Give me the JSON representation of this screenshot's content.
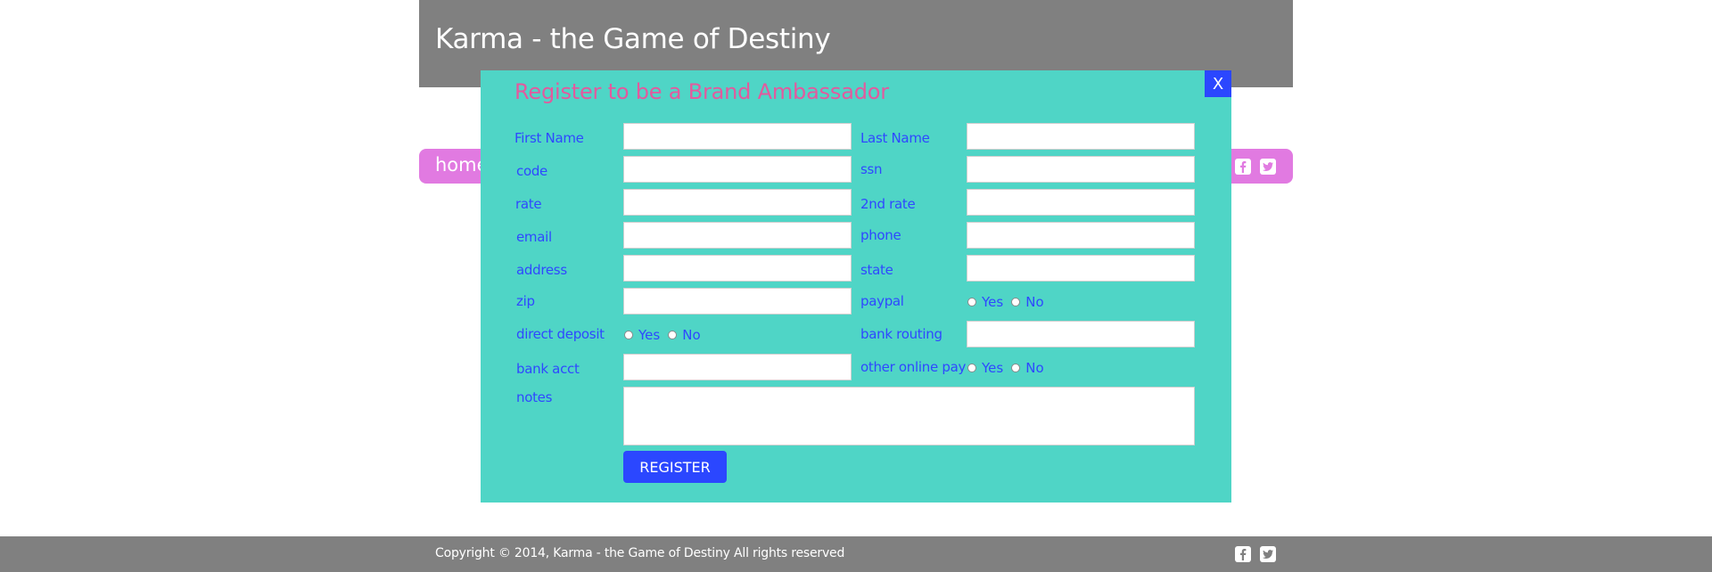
{
  "site": {
    "title": "Karma - the Game of Destiny"
  },
  "nav": {
    "home": "home"
  },
  "social": {
    "facebook_icon": "facebook-icon",
    "twitter_icon": "twitter-icon"
  },
  "modal": {
    "close_label": "X",
    "title": "Register to be a Brand Ambassador",
    "fields": {
      "first_name": {
        "label": "First Name",
        "value": ""
      },
      "last_name": {
        "label": "Last Name",
        "value": ""
      },
      "code": {
        "label": "code",
        "value": ""
      },
      "ssn": {
        "label": "ssn",
        "value": ""
      },
      "rate": {
        "label": "rate",
        "value": ""
      },
      "rate2": {
        "label": "2nd rate",
        "value": ""
      },
      "email": {
        "label": "email",
        "value": ""
      },
      "phone": {
        "label": "phone",
        "value": ""
      },
      "address": {
        "label": "address",
        "value": ""
      },
      "state": {
        "label": "state",
        "value": ""
      },
      "zip": {
        "label": "zip",
        "value": ""
      },
      "paypal": {
        "label": "paypal",
        "yes": "Yes",
        "no": "No"
      },
      "direct_deposit": {
        "label": "direct deposit",
        "yes": "Yes",
        "no": "No"
      },
      "bank_routing": {
        "label": "bank routing",
        "value": ""
      },
      "bank_acct": {
        "label": "bank acct",
        "value": ""
      },
      "other_online_pay": {
        "label": "other online pay",
        "yes": "Yes",
        "no": "No"
      },
      "notes": {
        "label": "notes",
        "value": ""
      }
    },
    "register_label": "REGISTER"
  },
  "footer": {
    "copyright": "Copyright © 2014, Karma - the Game of Destiny  All rights reserved"
  },
  "colors": {
    "header_bg": "#808080",
    "nav_bg": "#e17ae1",
    "modal_bg": "#4fd5c6",
    "accent_blue": "#2b47ff",
    "title_pink": "#e25a9e",
    "label_blue": "#2f48ff"
  }
}
